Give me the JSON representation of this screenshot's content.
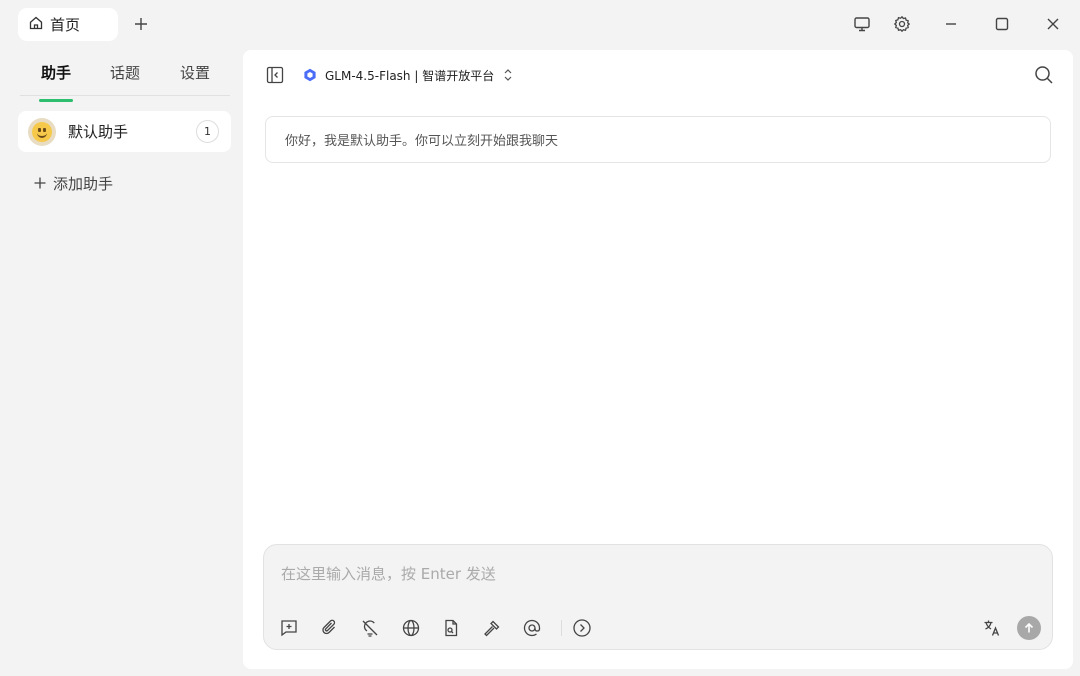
{
  "titlebar": {
    "home_tab_label": "首页",
    "icons": [
      "home-icon",
      "plus-icon",
      "monitor-icon",
      "gear-icon",
      "minimize-icon",
      "maximize-icon",
      "close-icon"
    ]
  },
  "sidebar": {
    "tabs": [
      {
        "label": "助手",
        "active": true
      },
      {
        "label": "话题",
        "active": false
      },
      {
        "label": "设置",
        "active": false
      }
    ],
    "assistants": [
      {
        "name": "默认助手",
        "count": "1"
      }
    ],
    "add_label": "添加助手",
    "accent_color": "#2dbd6e"
  },
  "main": {
    "model_label": "GLM-4.5-Flash | 智谱开放平台",
    "welcome_message": "你好，我是默认助手。你可以立刻开始跟我聊天",
    "input_placeholder": "在这里输入消息，按 Enter 发送",
    "toolbar_icons": [
      "new-topic-icon",
      "attachment-icon",
      "thinking-off-icon",
      "web-search-icon",
      "knowledge-icon",
      "tools-icon",
      "mention-icon",
      "expand-icon",
      "translate-icon",
      "send-icon"
    ]
  }
}
